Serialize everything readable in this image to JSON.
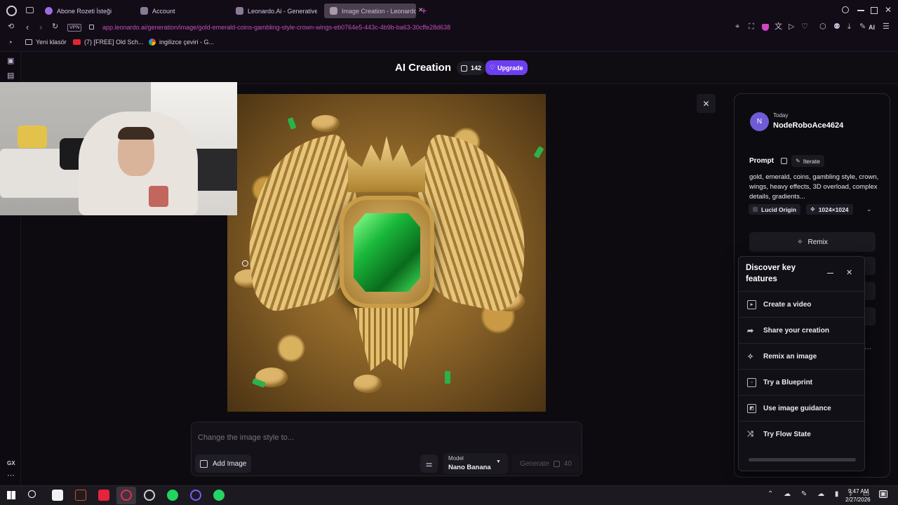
{
  "browser": {
    "tabs": [
      {
        "label": "Abone Rozeti İsteği",
        "active": false
      },
      {
        "label": "Account",
        "active": false
      },
      {
        "label": "Leonardo.Ai - Generative",
        "active": false
      },
      {
        "label": "Image Creation - Leonardo",
        "active": true
      }
    ],
    "vpn_label": "VPN",
    "url": "app.leonardo.ai/generation/image/gold-emerald-coins-gambling-style-crown-wings-eb0764e5-443c-4b9b-ba63-30cffe28d638",
    "bookmarks": [
      {
        "label": "Yeni klasör",
        "icon": "folder-icon"
      },
      {
        "label": "(7) [FREE] Old Sch...",
        "icon": "youtube-icon"
      },
      {
        "label": "ingilizce çeviri - G...",
        "icon": "google-icon"
      }
    ],
    "ai_label": "AI",
    "gx_label": "GX"
  },
  "app": {
    "title": "AI Creation",
    "tokens": "142",
    "upgrade_label": "Upgrade"
  },
  "prompt_bar": {
    "placeholder": "Change the image style to...",
    "add_image_label": "Add Image",
    "model_caption": "Model",
    "model_value": "Nano Banana",
    "generate_label": "Generate",
    "generate_cost": "40"
  },
  "panel": {
    "avatar_letter": "N",
    "date": "Today",
    "username": "NodeRoboAce4624",
    "prompt_heading": "Prompt",
    "iterate_label": "Iterate",
    "prompt_text": "gold, emerald, coins, gambling style, crown, wings, heavy effects, 3D overload, complex details, gradients...",
    "model_chip": "Lucid Origin",
    "size_chip": "1024×1024",
    "remix_label": "Remix"
  },
  "discover": {
    "title": "Discover key features",
    "items": [
      {
        "label": "Create a video",
        "icon": "video-icon"
      },
      {
        "label": "Share your creation",
        "icon": "share-icon"
      },
      {
        "label": "Remix an image",
        "icon": "remix-icon"
      },
      {
        "label": "Try a Blueprint",
        "icon": "blueprint-icon"
      },
      {
        "label": "Use image guidance",
        "icon": "image-guidance-icon"
      },
      {
        "label": "Try Flow State",
        "icon": "flow-state-icon"
      }
    ]
  },
  "taskbar": {
    "time": "9:47 AM",
    "date": "2/27/2026"
  },
  "colors": {
    "accent_purple": "#7c4dff",
    "url_pink": "#d45cc8",
    "background": "#0d0b10",
    "emerald": "#19b83a",
    "gold": "#c9a24a"
  }
}
